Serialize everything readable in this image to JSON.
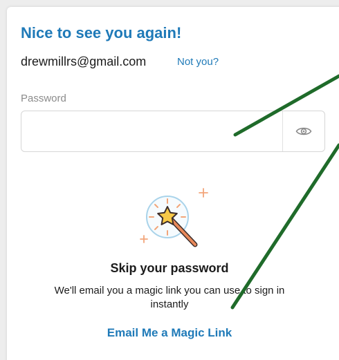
{
  "login": {
    "title": "Nice to see you again!",
    "email": "drewmillrs@gmail.com",
    "not_you_label": "Not you?",
    "password_label": "Password",
    "password_value": "",
    "password_placeholder": ""
  },
  "magic_link": {
    "title": "Skip your password",
    "description": "We'll email you a magic link you can use to sign in instantly",
    "button_label": "Email Me a Magic Link"
  },
  "icons": {
    "password_toggle": "eye-icon",
    "illustration": "magic-wand-icon"
  },
  "colors": {
    "accent": "#1f7ab8",
    "text": "#1b1b1b",
    "muted": "#8b8b8b",
    "annotation": "#1f6b2a",
    "sparkle": "#f2a57a",
    "wand_star": "#f7c948"
  }
}
